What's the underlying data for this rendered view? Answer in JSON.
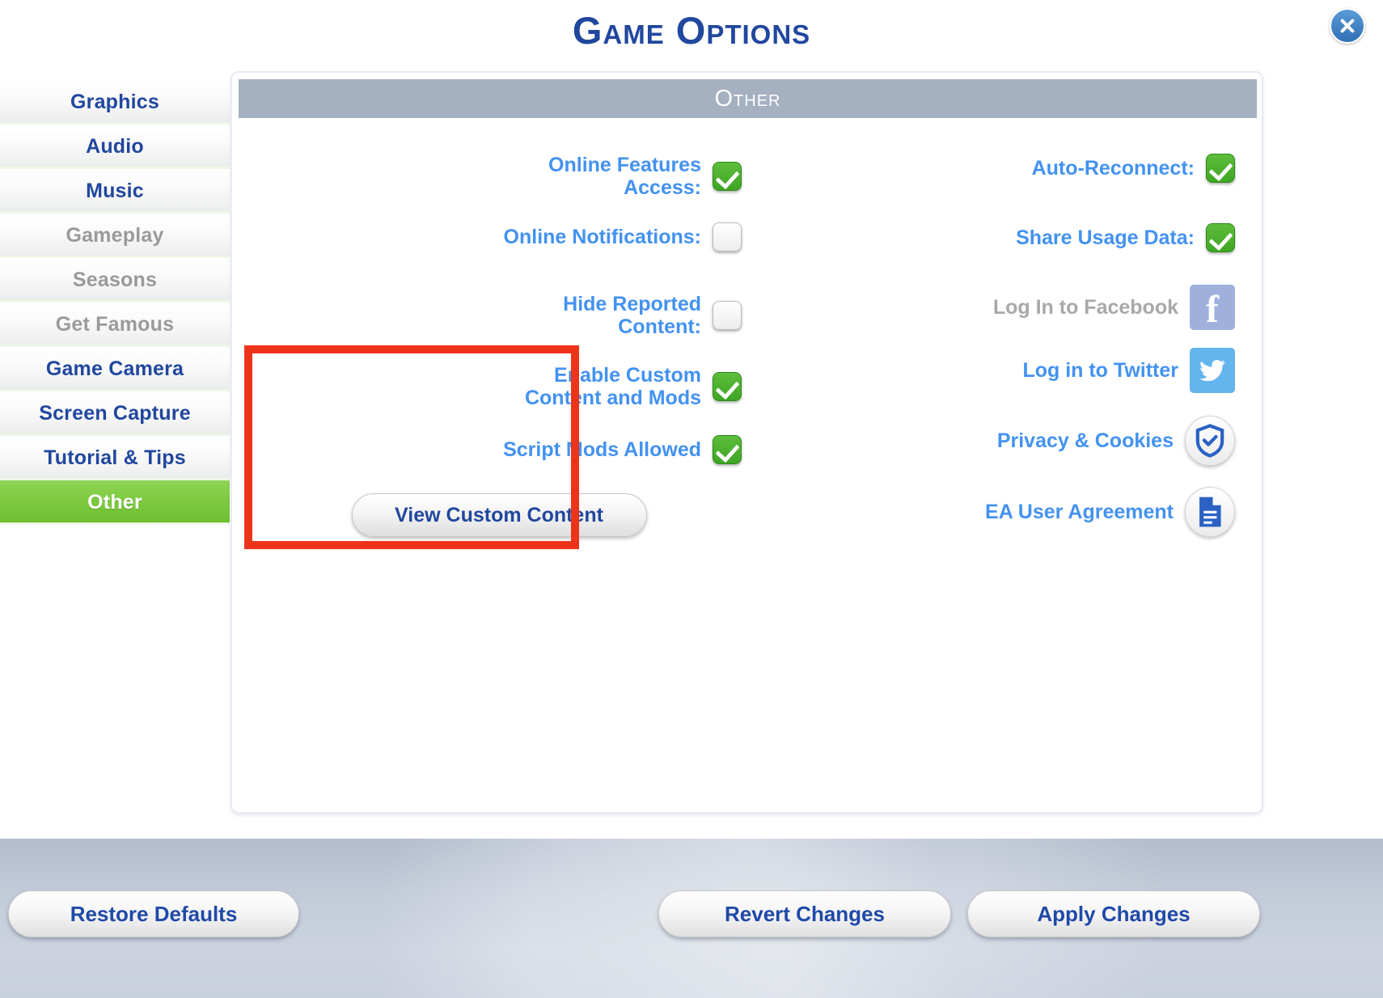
{
  "window": {
    "title": "Game Options",
    "close_icon": "close-icon"
  },
  "sidebar": {
    "items": [
      {
        "label": "Graphics",
        "state": "enabled"
      },
      {
        "label": "Audio",
        "state": "enabled"
      },
      {
        "label": "Music",
        "state": "enabled"
      },
      {
        "label": "Gameplay",
        "state": "disabled"
      },
      {
        "label": "Seasons",
        "state": "disabled"
      },
      {
        "label": "Get Famous",
        "state": "disabled"
      },
      {
        "label": "Game Camera",
        "state": "enabled"
      },
      {
        "label": "Screen Capture",
        "state": "enabled"
      },
      {
        "label": "Tutorial & Tips",
        "state": "enabled"
      },
      {
        "label": "Other",
        "state": "active"
      }
    ]
  },
  "panel": {
    "header": "Other",
    "left_column": [
      {
        "label": "Online Features\nAccess:",
        "control": "checkbox",
        "checked": true
      },
      {
        "label": "Online Notifications:",
        "control": "checkbox",
        "checked": false
      },
      {
        "label": "Hide Reported\nContent:",
        "control": "checkbox",
        "checked": false
      },
      {
        "label": "Enable Custom\nContent and Mods",
        "control": "checkbox",
        "checked": true
      },
      {
        "label": "Script Mods Allowed",
        "control": "checkbox",
        "checked": true
      }
    ],
    "view_custom_content_button": "View Custom Content",
    "right_column": [
      {
        "label": "Auto-Reconnect:",
        "control": "checkbox",
        "checked": true,
        "state": "enabled"
      },
      {
        "label": "Share Usage Data:",
        "control": "checkbox",
        "checked": true,
        "state": "enabled"
      },
      {
        "label": "Log In to Facebook",
        "control": "facebook-icon",
        "state": "disabled"
      },
      {
        "label": "Log in to Twitter",
        "control": "twitter-icon",
        "state": "enabled"
      },
      {
        "label": "Privacy & Cookies",
        "control": "shield-check-icon",
        "state": "enabled"
      },
      {
        "label": "EA User Agreement",
        "control": "document-icon",
        "state": "enabled"
      }
    ]
  },
  "annotation": {
    "highlight_color": "#ed3419"
  },
  "bottom_bar": {
    "restore_defaults": "Restore Defaults",
    "revert_changes": "Revert Changes",
    "apply_changes": "Apply Changes"
  },
  "colors": {
    "title_blue": "#21479e",
    "label_blue": "#4392f0",
    "disabled_grey": "#a8a8a8",
    "active_green": "#7cc93f",
    "header_grey": "#a5b0c0",
    "checkbox_green": "#3fa524",
    "facebook_blue": "#9fb0dd",
    "twitter_blue": "#64b4ed"
  }
}
